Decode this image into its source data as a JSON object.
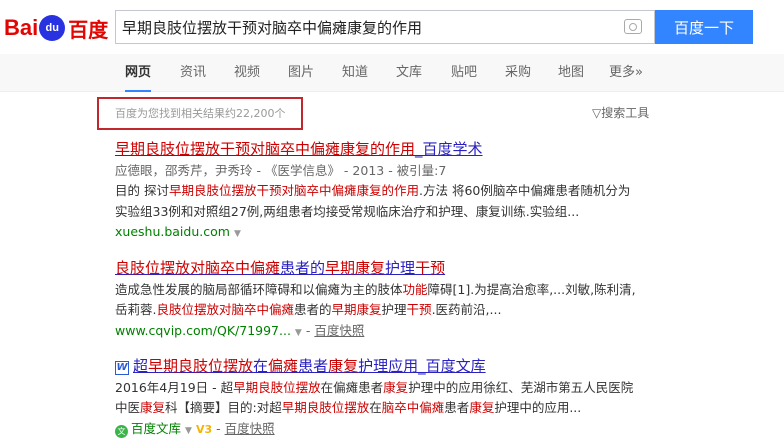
{
  "logo": {
    "text1": "Bai",
    "text2": "du",
    "text3": "百度"
  },
  "search": {
    "value": "早期良肢位摆放干预对脑卒中偏瘫康复的作用",
    "button": "百度一下"
  },
  "nav": [
    "网页",
    "资讯",
    "视频",
    "图片",
    "知道",
    "文库",
    "贴吧",
    "采购",
    "地图",
    "更多»"
  ],
  "result_count": "百度为您找到相关结果约22,200个",
  "search_tools": "搜索工具",
  "results": [
    {
      "title": [
        {
          "t": "早期良肢位摆放干预对脑卒中偏瘫康复的作用",
          "h": 1
        },
        {
          "t": "_百度学术",
          "h": 0
        }
      ],
      "meta": "应德眼，邵秀芹，尹秀玲 - 《医学信息》 - 2013 - 被引量:7",
      "body": [
        [
          {
            "t": "目的 探讨",
            "h": 0
          },
          {
            "t": "早期良肢位摆放干预对脑卒中偏瘫康复的作用",
            "h": 1
          },
          {
            "t": ".方法 将60例脑卒中偏瘫患者随机分为",
            "h": 0
          }
        ],
        [
          {
            "t": "实验组33例和对照组27例,两组患者均接受常规临床治疗和护理、康复训练.实验组...",
            "h": 0
          }
        ]
      ],
      "url": "xueshu.baidu.com"
    },
    {
      "title": [
        {
          "t": "良肢位摆放对脑卒中偏瘫",
          "h": 1
        },
        {
          "t": "患者的",
          "h": 0
        },
        {
          "t": "早期康复",
          "h": 1
        },
        {
          "t": "护理",
          "h": 0
        },
        {
          "t": "干预",
          "h": 1
        }
      ],
      "body": [
        [
          {
            "t": "造成急性发展的脑局部循环障碍和以偏瘫为主的肢体",
            "h": 0
          },
          {
            "t": "功能",
            "h": 1
          },
          {
            "t": "障碍[1].为提高治愈率,...刘敏,陈利清,",
            "h": 0
          }
        ],
        [
          {
            "t": "岳莉蓉.",
            "h": 0
          },
          {
            "t": "良肢位摆放对脑卒中偏瘫",
            "h": 1
          },
          {
            "t": "患者的",
            "h": 0
          },
          {
            "t": "早期康复",
            "h": 1
          },
          {
            "t": "护理",
            "h": 0
          },
          {
            "t": "干预",
            "h": 1
          },
          {
            "t": ".医药前沿,...",
            "h": 0
          }
        ]
      ],
      "url": "www.cqvip.com/QK/71997...",
      "cache": "百度快照"
    },
    {
      "icon": "W",
      "title": [
        {
          "t": "超",
          "h": 0
        },
        {
          "t": "早期良肢位摆放",
          "h": 1
        },
        {
          "t": "在",
          "h": 0
        },
        {
          "t": "偏瘫",
          "h": 1
        },
        {
          "t": "患者",
          "h": 0
        },
        {
          "t": "康复",
          "h": 1
        },
        {
          "t": "护理应用_百度文库",
          "h": 0
        }
      ],
      "body": [
        [
          {
            "t": "2016年4月19日 - 超",
            "h": 0
          },
          {
            "t": "早期良肢位摆放",
            "h": 1
          },
          {
            "t": "在偏瘫患者",
            "h": 0
          },
          {
            "t": "康复",
            "h": 1
          },
          {
            "t": "护理中的应用徐红、芜湖市第五人民医院",
            "h": 0
          }
        ],
        [
          {
            "t": "中医",
            "h": 0
          },
          {
            "t": "康复",
            "h": 1
          },
          {
            "t": "科【摘要】目的:对超",
            "h": 0
          },
          {
            "t": "早期良肢位摆放",
            "h": 1
          },
          {
            "t": "在",
            "h": 0
          },
          {
            "t": "脑卒中偏瘫",
            "h": 1
          },
          {
            "t": "患者",
            "h": 0
          },
          {
            "t": "康复",
            "h": 1
          },
          {
            "t": "护理中的应用...",
            "h": 0
          }
        ]
      ],
      "source": "百度文库",
      "source_icon": "文",
      "level": "V3",
      "cache": "百度快照"
    }
  ],
  "colors": {
    "accent": "#3385ff",
    "highlight": "#cc0000",
    "link": "#2a22c0",
    "url": "#008000",
    "box": "#c0282d"
  }
}
